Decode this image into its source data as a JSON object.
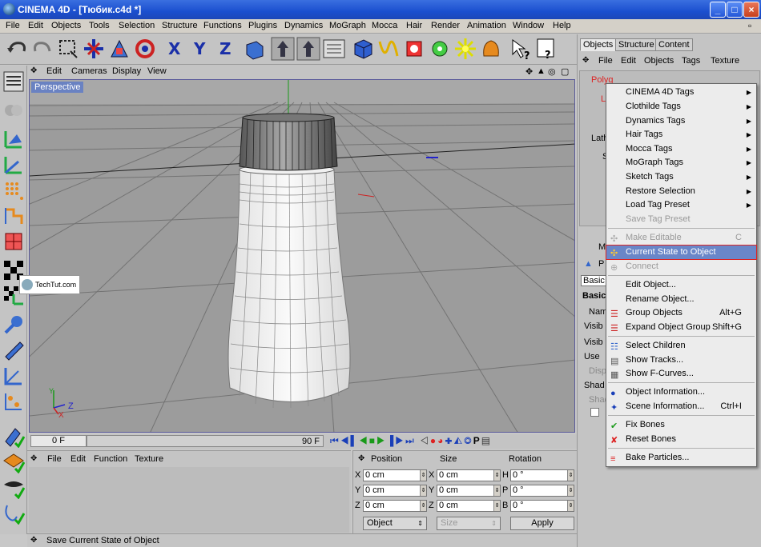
{
  "window": {
    "title": "CINEMA 4D - [Тюбик.c4d *]",
    "min": "_",
    "max": "□",
    "close": "×"
  },
  "menubar": [
    "File",
    "Edit",
    "Objects",
    "Tools",
    "Selection",
    "Structure",
    "Functions",
    "Plugins",
    "Dynamics",
    "MoGraph",
    "Mocca",
    "Hair",
    "Render",
    "Animation",
    "Window",
    "Help"
  ],
  "viewport": {
    "menu": [
      "Edit",
      "Cameras",
      "Display",
      "View"
    ],
    "label": "Perspective",
    "axis_y": "Y",
    "axis_z": "Z",
    "axis_x": "X"
  },
  "timeline": {
    "start_frame": "0 F",
    "end_frame": "90 F"
  },
  "material_manager": {
    "menu": [
      "File",
      "Edit",
      "Function",
      "Texture"
    ]
  },
  "coordinates": {
    "headers": {
      "position": "Position",
      "size": "Size",
      "rotation": "Rotation"
    },
    "rows": [
      {
        "l1": "X",
        "v1": "0 cm",
        "l2": "X",
        "v2": "0 cm",
        "l3": "H",
        "v3": "0 °"
      },
      {
        "l1": "Y",
        "v1": "0 cm",
        "l2": "Y",
        "v2": "0 cm",
        "l3": "P",
        "v3": "0 °"
      },
      {
        "l1": "Z",
        "v1": "0 cm",
        "l2": "Z",
        "v2": "0 cm",
        "l3": "B",
        "v3": "0 °"
      }
    ],
    "mode": "Object",
    "size_mode": "Size",
    "apply": "Apply"
  },
  "status": "Save Current State of Object",
  "right_panel": {
    "tabs": [
      "Objects",
      "Structure",
      "Content"
    ],
    "menu": [
      "File",
      "Edit",
      "Objects",
      "Tags",
      "Texture"
    ],
    "tree": [
      "Polyg",
      "L",
      "Lath",
      "S"
    ],
    "attr_labels": [
      "M",
      "P",
      "Basic",
      "Basic",
      "Nam",
      "Visib",
      "Visib",
      "Use",
      "Displ",
      "Shad",
      "Shad"
    ]
  },
  "context_menu": {
    "items": [
      {
        "label": "CINEMA 4D Tags",
        "submenu": true
      },
      {
        "label": "Clothilde Tags",
        "submenu": true
      },
      {
        "label": "Dynamics Tags",
        "submenu": true
      },
      {
        "label": "Hair Tags",
        "submenu": true
      },
      {
        "label": "Mocca Tags",
        "submenu": true
      },
      {
        "label": "MoGraph Tags",
        "submenu": true
      },
      {
        "label": "Sketch Tags",
        "submenu": true
      },
      {
        "label": "Restore Selection",
        "submenu": true
      },
      {
        "label": "Load Tag Preset",
        "submenu": true
      },
      {
        "label": "Save Tag Preset",
        "disabled": true
      },
      {
        "label": "Make Editable",
        "shortcut": "C",
        "disabled": true
      },
      {
        "label": "Current State to Object",
        "highlighted": true
      },
      {
        "label": "Connect",
        "disabled": true
      },
      {
        "label": "Edit Object..."
      },
      {
        "label": "Rename Object..."
      },
      {
        "label": "Group Objects",
        "shortcut": "Alt+G"
      },
      {
        "label": "Expand Object Group",
        "shortcut": "Shift+G"
      },
      {
        "label": "Select Children"
      },
      {
        "label": "Show Tracks..."
      },
      {
        "label": "Show F-Curves..."
      },
      {
        "label": "Object Information..."
      },
      {
        "label": "Scene Information...",
        "shortcut": "Ctrl+I"
      },
      {
        "label": "Fix Bones"
      },
      {
        "label": "Reset Bones"
      },
      {
        "label": "Bake Particles..."
      }
    ]
  },
  "watermark": "TechTut.com",
  "colors": {
    "title_blue": "#1b4fcf",
    "highlight": "#6a86c8",
    "highlight_border": "#dd2222",
    "viewport_bg": "#9a9a9a"
  }
}
